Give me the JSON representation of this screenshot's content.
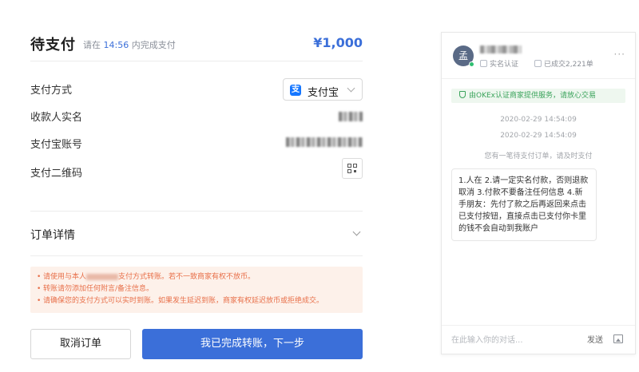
{
  "header": {
    "title": "待支付",
    "deadline_prefix": "请在",
    "deadline_time": "14:56",
    "deadline_suffix": "内完成支付",
    "amount": "¥1,000"
  },
  "payment": {
    "method_label": "支付方式",
    "method_value": "支付宝",
    "method_icon": "alipay-icon",
    "payee_label": "收款人实名",
    "account_label": "支付宝账号",
    "qrcode_label": "支付二维码"
  },
  "order": {
    "details_label": "订单详情"
  },
  "notice": {
    "line1_a": "请使用与本人",
    "line1_b": "支付方式转账。若不一致商家有权不放币。",
    "line2": "转账请勿添加任何附言/备注信息。",
    "line3": "请确保您的支付方式可以实时到账。如果发生延迟到账，商家有权延迟放币或拒绝成交。"
  },
  "actions": {
    "cancel_label": "取消订单",
    "confirm_label": "我已完成转账，下一步"
  },
  "chat": {
    "avatar_initial": "孟",
    "verify_label": "实名认证",
    "deals_label": "已成交2,221单",
    "more_label": "···",
    "safe_banner": "由OKEx认证商家提供服务，请放心交易",
    "timestamps": [
      "2020-02-29 14:54:09",
      "2020-02-29 14:54:09"
    ],
    "system_message": "您有一笔待支付订单，请及时支付",
    "message": "1.人在 2.请一定实名付款，否则退款取消 3.付款不要备注任何信息 4.新手朋友：先付了款之后再返回来点击已支付按钮，直接点击已支付你卡里的钱不会自动到我账户",
    "input_placeholder": "在此输入你的对话...",
    "send_label": "发送"
  },
  "colors": {
    "accent": "#3b6fd9",
    "notice_text": "#e8704a",
    "notice_bg": "#fdf1ea",
    "safe_green": "#3aa35b"
  }
}
